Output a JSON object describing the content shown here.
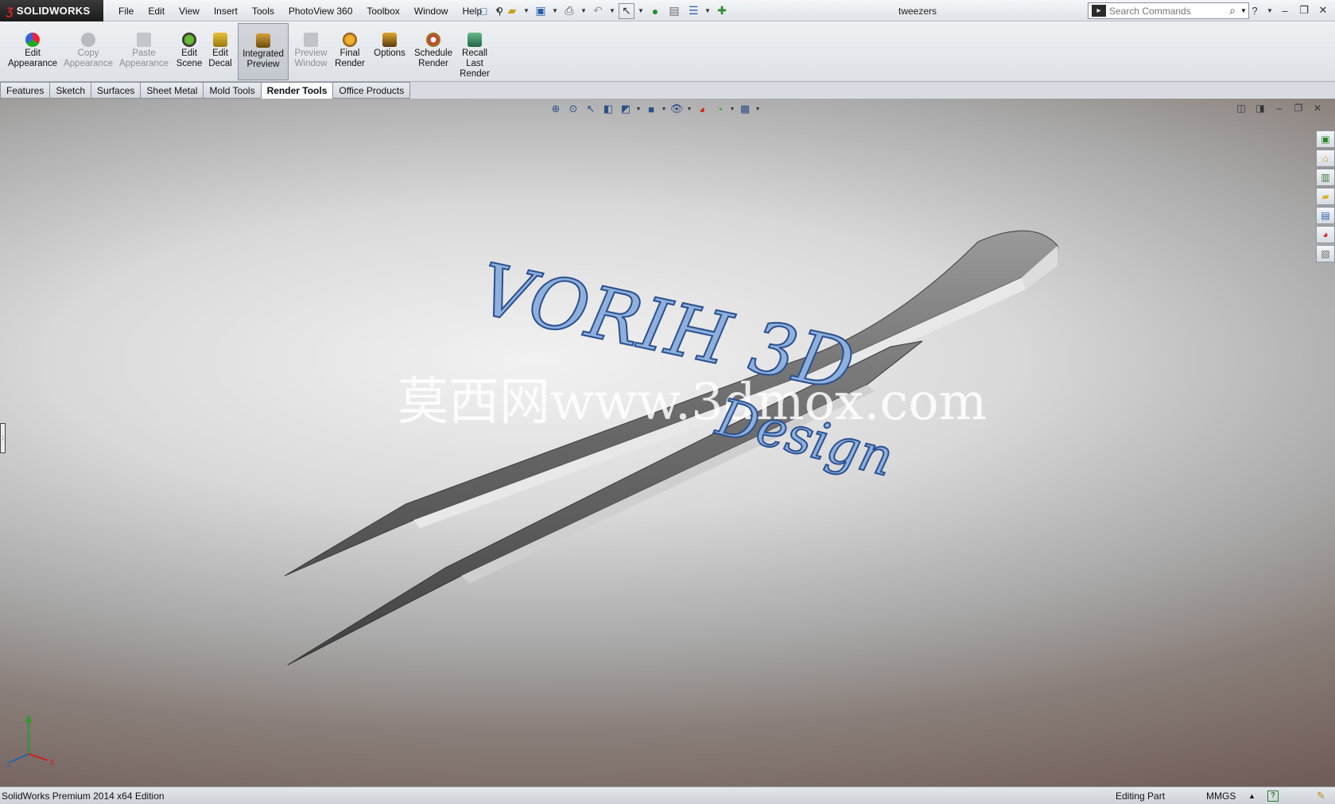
{
  "app": {
    "brand": "SOLIDWORKS",
    "doc_title": "tweezers"
  },
  "menu": [
    "File",
    "Edit",
    "View",
    "Insert",
    "Tools",
    "PhotoView 360",
    "Toolbox",
    "Window",
    "Help"
  ],
  "search": {
    "placeholder": "Search Commands"
  },
  "ribbon": {
    "edit_appearance": "Edit\nAppearance",
    "copy_appearance": "Copy\nAppearance",
    "paste_appearance": "Paste\nAppearance",
    "edit_scene": "Edit\nScene",
    "edit_decal": "Edit\nDecal",
    "integrated_preview": "Integrated\nPreview",
    "preview_window": "Preview\nWindow",
    "final_render": "Final\nRender",
    "options": "Options",
    "schedule_render": "Schedule\nRender",
    "recall_last_render": "Recall\nLast\nRender"
  },
  "tabs": [
    "Features",
    "Sketch",
    "Surfaces",
    "Sheet Metal",
    "Mold Tools",
    "Render Tools",
    "Office Products"
  ],
  "active_tab": "Render Tools",
  "watermark": {
    "line1": "VORIH 3D",
    "line2": "莫西网www.3dmox.com",
    "line3": "Design"
  },
  "status": {
    "edition": "SolidWorks Premium 2014 x64 Edition",
    "mode": "Editing Part",
    "units": "MMGS"
  },
  "colors": {
    "accent": "#2b5ea8",
    "brand_red": "#d9262c"
  }
}
